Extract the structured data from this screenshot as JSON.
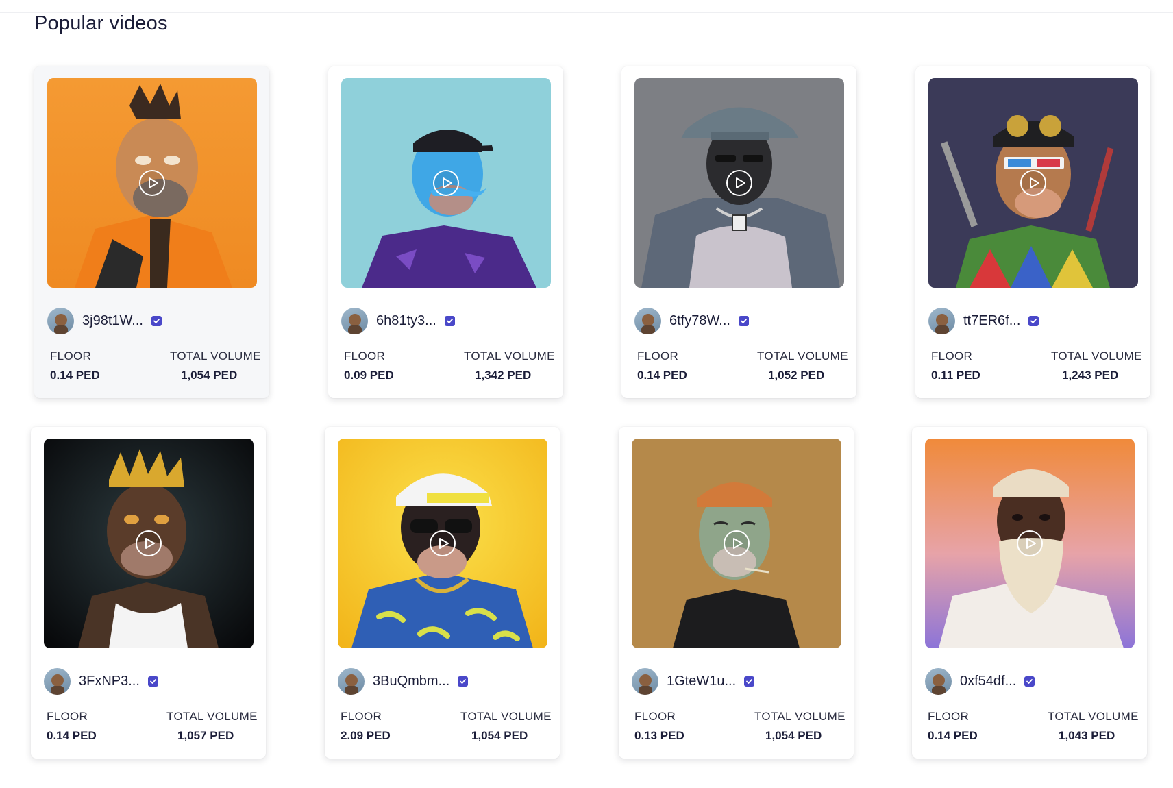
{
  "section": {
    "title": "Popular videos"
  },
  "cards": [
    {
      "handle": "3j98t1W...",
      "floor_label": "FLOOR",
      "floor_value": "0.14 PED",
      "volume_label": "TOTAL VOLUME",
      "volume_value": "1,054 PED",
      "theme": "orange tiger-striped ape"
    },
    {
      "handle": "6h81ty3...",
      "floor_label": "FLOOR",
      "floor_value": "0.09 PED",
      "volume_label": "TOTAL VOLUME",
      "volume_value": "1,342 PED",
      "theme": "blue ape with cap"
    },
    {
      "handle": "6tfy78W...",
      "floor_label": "FLOOR",
      "floor_value": "0.14 PED",
      "volume_label": "TOTAL VOLUME",
      "volume_value": "1,052 PED",
      "theme": "ape in bucket hat"
    },
    {
      "handle": "tt7ER6f...",
      "floor_label": "FLOOR",
      "floor_value": "0.11 PED",
      "volume_label": "TOTAL VOLUME",
      "volume_value": "1,243 PED",
      "theme": "ape with swords"
    },
    {
      "handle": "3FxNP3...",
      "floor_label": "FLOOR",
      "floor_value": "0.14 PED",
      "volume_label": "TOTAL VOLUME",
      "volume_value": "1,057 PED",
      "theme": "ape with gold crown"
    },
    {
      "handle": "3BuQmbm...",
      "floor_label": "FLOOR",
      "floor_value": "2.09 PED",
      "volume_label": "TOTAL VOLUME",
      "volume_value": "1,054 PED",
      "theme": "ape with banana shirt"
    },
    {
      "handle": "1GteW1u...",
      "floor_label": "FLOOR",
      "floor_value": "0.13 PED",
      "volume_label": "TOTAL VOLUME",
      "volume_value": "1,054 PED",
      "theme": "green ape with beanie"
    },
    {
      "handle": "0xf54df...",
      "floor_label": "FLOOR",
      "floor_value": "0.14 PED",
      "volume_label": "TOTAL VOLUME",
      "volume_value": "1,043 PED",
      "theme": "character with white beard"
    }
  ],
  "icons": {
    "play": "play-circle-icon",
    "verified": "verified-check-icon"
  },
  "colors": {
    "verified_badge": "#4a48c9",
    "text_dark": "#1b1d38"
  }
}
